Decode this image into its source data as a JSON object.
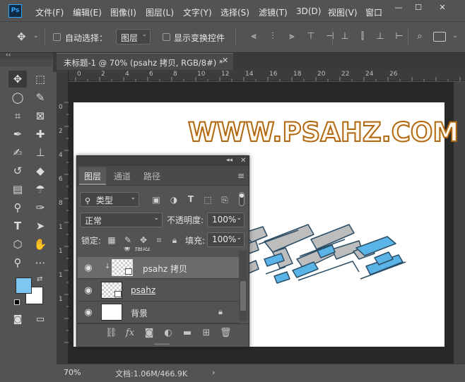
{
  "app": {
    "logo": "Ps",
    "menu": [
      "文件(F)",
      "编辑(E)",
      "图像(I)",
      "图层(L)",
      "文字(Y)",
      "选择(S)",
      "滤镜(T)",
      "3D(D)",
      "视图(V)",
      "窗口"
    ],
    "window_controls": [
      "minimize-icon",
      "maximize-icon",
      "close-icon"
    ]
  },
  "options_bar": {
    "move_icon": "move-icon",
    "auto_select_label": "自动选择：",
    "auto_select_target": "图层",
    "show_transform_label": "显示变换控件"
  },
  "document": {
    "tab_title": "未标题-1 @ 70% (psahz 拷贝, RGB/8#) *",
    "zoom": "70%",
    "doc_size": "文档:1.06M/466.9K",
    "ruler_ticks": [
      "0",
      "2",
      "4",
      "6",
      "8",
      "10",
      "12",
      "14",
      "16",
      "18",
      "20",
      "22",
      "24",
      "26"
    ],
    "ruler_left_ticks": [
      "0",
      "2",
      "4",
      "6",
      "8",
      "1",
      "1",
      "1",
      "1"
    ],
    "canvas_text": "WWW.PSAHZ.COM",
    "artwork_fill": "#5ab4e8",
    "artwork_side": "#bdbdbd"
  },
  "colors": {
    "foreground": "#7ec7f0",
    "background": "#ffffff",
    "accent": "#31a8ff"
  },
  "layers_panel": {
    "tabs": [
      "图层",
      "通道",
      "路径"
    ],
    "filter_kind": "类型",
    "blend_mode": "正常",
    "opacity_label": "不透明度:",
    "opacity_value": "100%",
    "lock_label": "锁定:",
    "fill_label": "填充:",
    "fill_value": "100%",
    "partial_layer": "描边",
    "layers": [
      {
        "name": "psahz 拷贝",
        "visible": true,
        "selected": true,
        "locked": false
      },
      {
        "name": "psahz",
        "visible": true,
        "selected": false,
        "locked": false
      },
      {
        "name": "背景",
        "visible": true,
        "selected": false,
        "locked": true
      }
    ]
  }
}
